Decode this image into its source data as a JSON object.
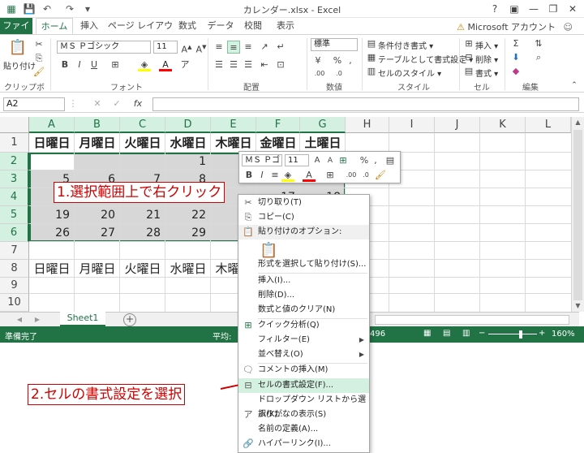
{
  "window": {
    "title": "カレンダー.xlsx - Excel",
    "help": "?",
    "minimize": "—",
    "restore": "❐",
    "close": "✕"
  },
  "tabs": [
    "ファイル",
    "ホーム",
    "挿入",
    "ページ レイアウト",
    "数式",
    "データ",
    "校閲",
    "表示"
  ],
  "account": "Microsoft アカウント",
  "ribbon": {
    "clipboard": {
      "label": "クリップボード",
      "paste": "貼り付け"
    },
    "font": {
      "label": "フォント",
      "name": "ＭＳ Ｐゴシック",
      "size": "11"
    },
    "alignment": {
      "label": "配置"
    },
    "number": {
      "label": "数値",
      "format": "標準"
    },
    "styles": {
      "label": "スタイル",
      "conditional": "条件付き書式 ▾",
      "as_table": "テーブルとして書式設定 ▾",
      "cell_styles": "セルのスタイル ▾"
    },
    "cells": {
      "label": "セル",
      "insert": "挿入 ▾",
      "delete": "削除 ▾",
      "format": "書式 ▾"
    },
    "editing": {
      "label": "編集"
    }
  },
  "formula_bar": {
    "name_box": "A2",
    "fx": "fx",
    "content": ""
  },
  "columns": [
    "A",
    "B",
    "C",
    "D",
    "E",
    "F",
    "G",
    "H",
    "I",
    "J",
    "K",
    "L"
  ],
  "rows": [
    "1",
    "2",
    "3",
    "4",
    "5",
    "6",
    "7",
    "8",
    "9",
    "10"
  ],
  "weekdays": [
    "日曜日",
    "月曜日",
    "火曜日",
    "水曜日",
    "木曜日",
    "金曜日",
    "土曜日"
  ],
  "calendar": {
    "row2": [
      "",
      "",
      "",
      "1",
      "",
      "",
      ""
    ],
    "row3": [
      "5",
      "6",
      "7",
      "8",
      "",
      "",
      ""
    ],
    "row4": [
      "",
      "",
      "",
      "",
      "",
      "17",
      "18"
    ],
    "row5": [
      "19",
      "20",
      "21",
      "22",
      "",
      "",
      ""
    ],
    "row6": [
      "26",
      "27",
      "28",
      "29",
      "",
      "",
      ""
    ]
  },
  "row8_weekdays": [
    "日曜日",
    "月曜日",
    "火曜日",
    "水曜日",
    "木曜日"
  ],
  "mini_toolbar": {
    "font": "ＭＳ Ｐゴ",
    "size": "11",
    "percent": "%",
    "comma": ","
  },
  "context_menu": {
    "cut": "切り取り(T)",
    "copy": "コピー(C)",
    "paste_options": "貼り付けのオプション:",
    "paste_special": "形式を選択して貼り付け(S)...",
    "insert": "挿入(I)...",
    "delete": "削除(D)...",
    "clear": "数式と値のクリア(N)",
    "quick_analysis": "クイック分析(Q)",
    "filter": "フィルター(E)",
    "sort": "並べ替え(O)",
    "insert_comment": "コメントの挿入(M)",
    "format_cells": "セルの書式設定(F)...",
    "dropdown": "ドロップダウン リストから選択(K)...",
    "phonetic": "ふりがなの表示(S)",
    "define_name": "名前の定義(A)...",
    "hyperlink": "ハイパーリンク(I)..."
  },
  "sheet": {
    "tab": "Sheet1",
    "add": "+"
  },
  "status": {
    "ready": "準備完了",
    "average": "平均:",
    "count": "496",
    "zoom": "160%"
  },
  "callouts": {
    "step1": "1.選択範囲上で右クリック",
    "step2": "2.セルの書式設定を選択"
  },
  "colors": {
    "accent": "#217346",
    "callout": "#d00000",
    "selection": "#d3f0e0"
  }
}
